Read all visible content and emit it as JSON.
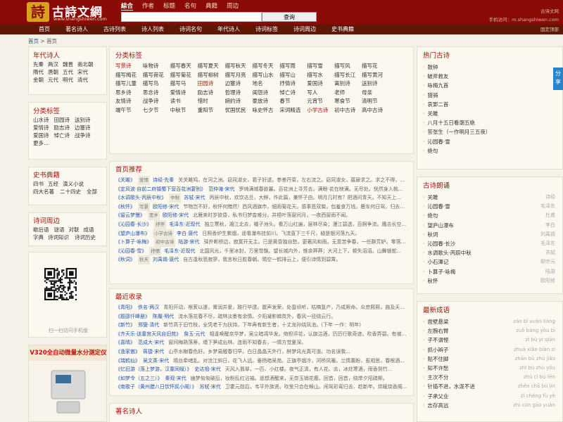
{
  "header": {
    "logo_seal": "詩",
    "logo_title": "古詩文網",
    "logo_url": "www.shangshiwen.com",
    "search_tabs": [
      "綜合",
      "作者",
      "标题",
      "名句",
      "典籍",
      "周边"
    ],
    "search_placeholder": "",
    "search_button": "查询",
    "right_line1": "古诗文网",
    "right_line2": "手机访问：m.shangshiwen.com"
  },
  "nav": {
    "items": [
      "首页",
      "著名诗人",
      "古诗列表",
      "诗人列表",
      "诗词名句",
      "年代诗人",
      "诗词标签",
      "诗词周边",
      "史书典籍"
    ],
    "login": "固定顶部"
  },
  "breadcrumb": {
    "home": "首页",
    "sep": " > ",
    "current": "首页"
  },
  "left": {
    "era": {
      "title": "年代诗人",
      "items": [
        "先秦",
        "两汉",
        "魏晋",
        "南北朝",
        "隋代",
        "唐朝",
        "五代",
        "宋代",
        "金朝",
        "元代",
        "明代",
        "清代"
      ]
    },
    "category": {
      "title": "分类标签",
      "items": [
        "山水诗",
        "田园诗",
        "送别诗",
        "爱情诗",
        "励志诗",
        "边塞诗",
        "爱国诗",
        "悼亡诗",
        "战争诗",
        "更多..."
      ]
    },
    "books": {
      "title": "史书典籍",
      "items": [
        "四书",
        "五经",
        "演义小说",
        "四大名著",
        "二十四史",
        "全部"
      ]
    },
    "around": {
      "title": "诗词周边",
      "items": [
        "歇后语",
        "谜语",
        "对联",
        "成语",
        "字典",
        "诗词知识",
        "诗词历史"
      ]
    },
    "qr_caption": "扫一扫访问手机版",
    "ad_title": "V320全自动微量水分测定仪"
  },
  "classify": {
    "title": "分类标签",
    "items": [
      "写景诗",
      "咏物诗",
      "描写春天",
      "描写夏天",
      "描写秋天",
      "描写冬天",
      "描写雨",
      "描写雪",
      "描写风",
      "描写花",
      "描写梅花",
      "描写荷花",
      "描写菊花",
      "描写柳树",
      "描写月亮",
      "描写山水",
      "描写山",
      "描写水",
      "描写长江",
      "描写黄河",
      "描写儿童",
      "描写鸟",
      "描写马",
      "田园诗",
      "边塞诗",
      "地名",
      "抒情诗",
      "爱国诗",
      "离别诗",
      "送别诗",
      "思乡诗",
      "思念诗",
      "爱情诗",
      "励志诗",
      "哲理诗",
      "闺怨诗",
      "悼亡诗",
      "写人",
      "老师",
      "母亲",
      "友情诗",
      "战争诗",
      "读书",
      "惜时",
      "婉约诗",
      "豪放诗",
      "春节",
      "元宵节",
      "寒食节",
      "清明节",
      "端午节",
      "七夕节",
      "中秋节",
      "重阳节",
      "忧国忧民",
      "咏史怀古",
      "宋词精选",
      "小学古诗",
      "初中古诗",
      "高中古诗"
    ],
    "red_items": [
      "写景诗",
      "田园诗",
      "小学古诗"
    ]
  },
  "recommend": {
    "title": "首页推荐",
    "rows": [
      {
        "title": "《关雎》",
        "tag": "爱情",
        "author": "诗经·先秦",
        "excerpt": "关关雎鸠，在河之洲。窈窕淑女，君子好逑。参差荇菜，左右流之。窈窕淑女，寤寐求之。求之不得，寤..."
      },
      {
        "title": "《定风波·自前二府镇蜀下营百花洲宴别》",
        "tag": "",
        "author": "范仲淹·宋代",
        "excerpt": "罗绮满城春欲暮。百花洲上寻芳去。满眼·花在映满。无尽处。恍然身入桃..."
      },
      {
        "title": "《水调歌头·丙辰中秋》",
        "tag": "中秋",
        "author": "苏轼·宋代",
        "excerpt": "丙辰中秋，欢饮达旦，大醉，作此篇，兼怀子由。明月几时有？把酒问青天。不知天上..."
      },
      {
        "title": "《秋怀》",
        "tag": "写景",
        "author": "欧阳修·宋代",
        "excerpt": "节物岂不好，秋怀何黯然！西风酒旗市，细雨菊花天。感事悲双鬓，包羞食万钱。鹿车何日驾，归去颍..."
      },
      {
        "title": "《留云梦慢》",
        "tag": "思乡",
        "author": "欧阳修·宋代",
        "excerpt": "北雁来时岁欲昏，私书归梦杳难分。井梧叶落窗间月，一夜西窗雨不闻。"
      },
      {
        "title": "《沁园春·长沙》",
        "tag": "抒怀",
        "author": "毛泽东·近现代",
        "excerpt": "独立寒秋，湘江北去，橘子洲头。看万山红遍，层林尽染；漫江碧透，百舸争流。鹰击长空..."
      },
      {
        "title": "《望庐山瀑布》",
        "tag": "小学古诗",
        "author": "李白·唐代",
        "excerpt": "日照香炉生紫烟，遥看瀑布挂前川。飞流直下三千尺，疑是银河落九天。"
      },
      {
        "title": "《卜算子·咏梅》",
        "tag": "初中古诗",
        "author": "陆游·宋代",
        "excerpt": "驿外断桥边，寂寞开无主。已是黄昏独自愁，更著风和雨。无意苦争春，一任群芳妒。零落成泥..."
      },
      {
        "title": "《沁园春·雪》",
        "tag": "抒情",
        "author": "毛泽东·近现代",
        "excerpt": "北国风光，千里冰封，万里雪飘。望长城内外，惟余莽莽；大河上下，顿失滔滔。山舞银蛇..."
      },
      {
        "title": "《秋词》",
        "tag": "秋天",
        "author": "刘禹锡·唐代",
        "excerpt": "自古逢秋悲寂寥，我言秋日胜春朝。晴空一鹤排云上，便引诗情到碧霄。"
      }
    ]
  },
  "recent": {
    "title": "最近收录",
    "rows": [
      {
        "title": "《青阳》",
        "tag": "",
        "author": "佚名·两汉",
        "excerpt": "青阳开动，根荄以遂，膏润并爱，跂行毕逮。霆声发荣，处壹顷听，枯槁复产，乃成厥命。众庶熙熙，施及夭胎..."
      },
      {
        "title": "《题邵仟峰册》",
        "tag": "",
        "author": "陈履·明代",
        "excerpt": "流水落花春不尽，疏林淡墨有余情。夕阳凝影蝉岚外，春风一径绕云行。"
      },
      {
        "title": "《新竹》",
        "tag": "",
        "author": "郑燮·清代",
        "excerpt": "新竹高于旧竹枝，全凭老干为扶持。下年再有新生者，十丈龙孙绕凤池。(下年 一作：明年)"
      },
      {
        "title": "《齐天乐·送童宫天风自旧苑》",
        "tag": "",
        "author": "詹玉·元代",
        "excerpt": "相逢唤醒京华梦，吴尘暗凋华发。倚担评花，认旗沽酒，历历行歌奇迹。吹香弄碧。有坡柳风情..."
      },
      {
        "title": "《喜晴》",
        "tag": "",
        "author": "范成大·宋代",
        "excerpt": "窗间梅熟落蒂，墙下笋成出林。连雨不知春去，一晴方觉夏深。"
      },
      {
        "title": "《渔家傲》",
        "tag": "",
        "author": "蒋捷·宋代",
        "excerpt": "山亭水榭春色好。乡梦易醒春归早。白日晶晶天外行，醉梦风光真可道。功名误我..."
      },
      {
        "title": "《瑞鹤仙》",
        "tag": "",
        "author": "吴文英·宋代",
        "excerpt": "晴丝牵绪乱。对沧江斜日，花飞人远。垂杨暗吴苑。正旗亭烟冷，河桥风暖。兰情蕙盼，惹相思，春根酒畔..."
      },
      {
        "title": "《忆旧游（落上梦游，汉童同赋）》",
        "tag": "",
        "author": "史达祖·宋代",
        "excerpt": "天风入翡翠，一匹、小红楼。夜气正清，有人花、去，冰炷寒酒，雨香到竹..."
      },
      {
        "title": "《如梦令（五之三）》",
        "tag": "",
        "author": "秦观·宋代",
        "excerpt": "幽梦匆匆破后，妆粉乱红沾袖。遥想酒醒来，无奈玉销花瘦。回首，回首，绕岸夕阳疏柳。"
      },
      {
        "title": "《南歌子（黄州腊八日饮怀民小阁）》",
        "tag": "",
        "author": "苏轼·宋代",
        "excerpt": "卫霍元勋后，韦平外族贤。吹笙只合在缑山。闲驾彩鸾归去、趁新年。烘暖烧香阁..."
      }
    ]
  },
  "poets_title": "著名诗人",
  "hot": {
    "title": "热门古诗",
    "items": [
      "鼓钟",
      "破斧救友",
      "咏梅九首",
      "猎骑",
      "哀郢二首",
      "关雎",
      "八月十五日看潮五绝",
      "答张生（一作明月三五夜）",
      "沁园春·雪",
      "绝句"
    ]
  },
  "read": {
    "title": "古诗朗诵",
    "items": [
      {
        "name": "关雎",
        "sub": "诗经"
      },
      {
        "name": "沁园春·雪",
        "sub": "毛泽东"
      },
      {
        "name": "绝句",
        "sub": "杜甫"
      },
      {
        "name": "望庐山瀑布",
        "sub": "李白"
      },
      {
        "name": "秋词",
        "sub": "刘禹锡"
      },
      {
        "name": "沁园春·长沙",
        "sub": "毛泽东"
      },
      {
        "name": "水调歌头·丙辰中秋",
        "sub": "苏轼"
      },
      {
        "name": "小石潭记",
        "sub": "柳宗元"
      },
      {
        "name": "卜算子·咏梅",
        "sub": "陆游"
      },
      {
        "name": "秋怀",
        "sub": "欧阳修"
      }
    ]
  },
  "idiom": {
    "title": "最新成语",
    "items": [
      {
        "name": "凿壁悬梁",
        "sub": "záo bì xuán liáng"
      },
      {
        "name": "左腕右臂",
        "sub": "zuǒ bàng yòu bì"
      },
      {
        "name": "子不谓悭",
        "sub": "zǐ bù yì qiān"
      },
      {
        "name": "抓小辫子",
        "sub": "zhuā xiǎo biàn zi"
      },
      {
        "name": "贴不住脚",
        "sub": "zhān bù zhù jiǎo"
      },
      {
        "name": "知不许愁",
        "sub": "zhī bù zhù yǒu"
      },
      {
        "name": "主次不分",
        "sub": "zhǔ cì bù fēn"
      },
      {
        "name": "针插不进，水泼不进",
        "sub": "zhēn chā bù jìn"
      },
      {
        "name": "子承父业",
        "sub": "zǐ chéng fù yè"
      },
      {
        "name": "志存高远",
        "sub": "zhì cún gāo yuǎn"
      }
    ]
  },
  "share_label": "分享",
  "colors": {
    "header": "#8a0a05",
    "nav": "#5f1705",
    "accent": "#a0160b",
    "link": "#2255aa"
  }
}
